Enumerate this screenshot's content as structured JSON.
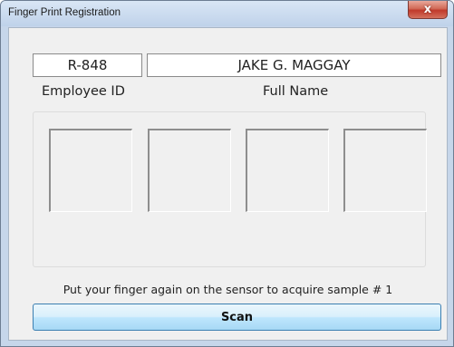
{
  "window": {
    "title": "Finger Print Registration",
    "close_glyph": "x"
  },
  "employee": {
    "id_value": "R-848",
    "id_label": "Employee ID",
    "name_value": "JAKE G. MAGGAY",
    "name_label": "Full Name"
  },
  "samples": [
    {
      "name": "sample-1"
    },
    {
      "name": "sample-2"
    },
    {
      "name": "sample-3"
    },
    {
      "name": "sample-4"
    }
  ],
  "status_text": "Put your finger again on the sensor to acquire sample # 1",
  "scan_button_label": "Scan"
}
